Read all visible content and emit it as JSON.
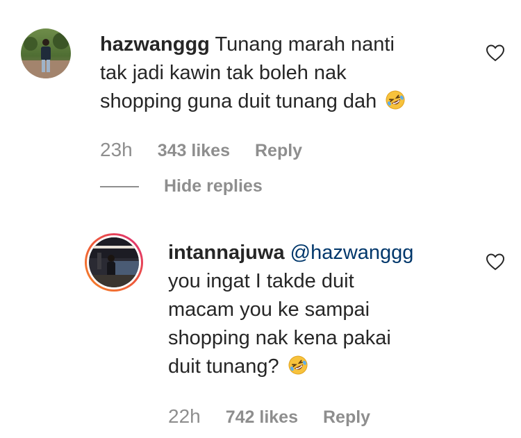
{
  "comments": [
    {
      "username": "hazwanggg",
      "text_line1": "Tunang marah nanti",
      "text_line2": "tak jadi kawin tak boleh nak",
      "text_line3": "shopping guna duit tunang dah",
      "emoji": "rolling-on-floor-laughing-emoji",
      "time": "23h",
      "likes": "343 likes",
      "reply_label": "Reply"
    }
  ],
  "hide_replies_label": "Hide replies",
  "replies": [
    {
      "username": "intannajuwa",
      "mention": "@hazwanggg",
      "text_line1": "you ingat I takde duit",
      "text_line2": "macam you ke sampai",
      "text_line3": "shopping nak kena pakai",
      "text_line4": "duit tunang?",
      "emoji": "rolling-on-floor-laughing-emoji",
      "time": "22h",
      "likes": "742 likes",
      "reply_label": "Reply",
      "story_ring": true
    }
  ],
  "colors": {
    "text": "#262626",
    "secondary": "#8e8e8e",
    "mention": "#00376b",
    "story_ring_start": "#f58529",
    "story_ring_end": "#dd2a7b"
  },
  "icons": {
    "like": "heart-outline-icon"
  }
}
